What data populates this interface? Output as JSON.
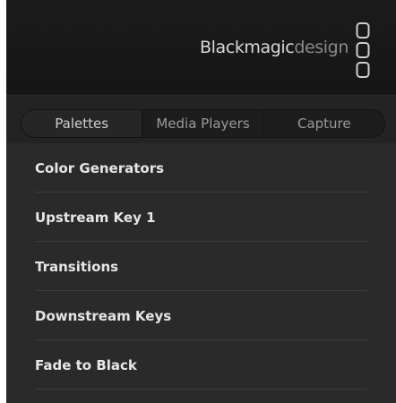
{
  "brand": {
    "name_strong": "Blackmagic",
    "name_light": "design",
    "logo_icon": "blackmagic-logo-icon"
  },
  "tabs": [
    {
      "label": "Palettes",
      "active": true
    },
    {
      "label": "Media Players",
      "active": false
    },
    {
      "label": "Capture",
      "active": false
    }
  ],
  "palettes": [
    {
      "label": "Color Generators"
    },
    {
      "label": "Upstream Key 1"
    },
    {
      "label": "Transitions"
    },
    {
      "label": "Downstream Keys"
    },
    {
      "label": "Fade to Black"
    }
  ],
  "colors": {
    "panel_background": "#2a2a2a",
    "header_background": "#1b1b1b",
    "text_primary": "#e6e6e6",
    "text_secondary": "#9a9a9a"
  }
}
